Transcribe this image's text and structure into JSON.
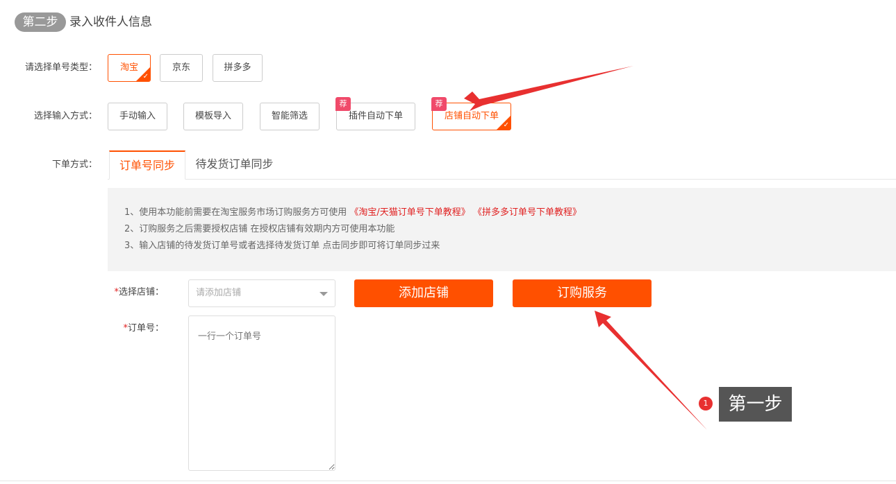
{
  "header": {
    "step_badge": "第二步",
    "title": "录入收件人信息"
  },
  "order_type": {
    "label": "请选择单号类型：",
    "options": [
      "淘宝",
      "京东",
      "拼多多"
    ],
    "selected": "淘宝"
  },
  "input_method": {
    "label": "选择输入方式：",
    "options": [
      "手动输入",
      "模板导入",
      "智能筛选",
      "插件自动下单",
      "店铺自动下单"
    ],
    "recommend_tag": "荐",
    "selected": "店铺自动下单"
  },
  "order_mode": {
    "label": "下单方式：",
    "tabs": [
      "订单号同步",
      "待发货订单同步"
    ],
    "active_tab": "订单号同步"
  },
  "notice": {
    "line1_prefix": "1、使用本功能前需要在淘宝服务市场订购服务方可使用",
    "line1_link1": "《淘宝/天猫订单号下单教程》",
    "line1_link2": "《拼多多订单号下单教程》",
    "line2": "2、订购服务之后需要授权店铺 在授权店铺有效期内方可使用本功能",
    "line3": "3、输入店铺的待发货订单号或者选择待发货订单 点击同步即可将订单同步过来"
  },
  "form": {
    "required_mark": "*",
    "shop_label": "选择店铺：",
    "shop_placeholder": "请添加店铺",
    "add_shop_button": "添加店铺",
    "subscribe_button": "订购服务",
    "order_no_label": "订单号：",
    "order_no_placeholder": "一行一个订单号"
  },
  "annotation": {
    "step_number": "1",
    "step_text": "第一步"
  },
  "colors": {
    "accent": "#ff5000",
    "recommend": "#f04a6a",
    "annotation_arrow": "#e83030"
  }
}
